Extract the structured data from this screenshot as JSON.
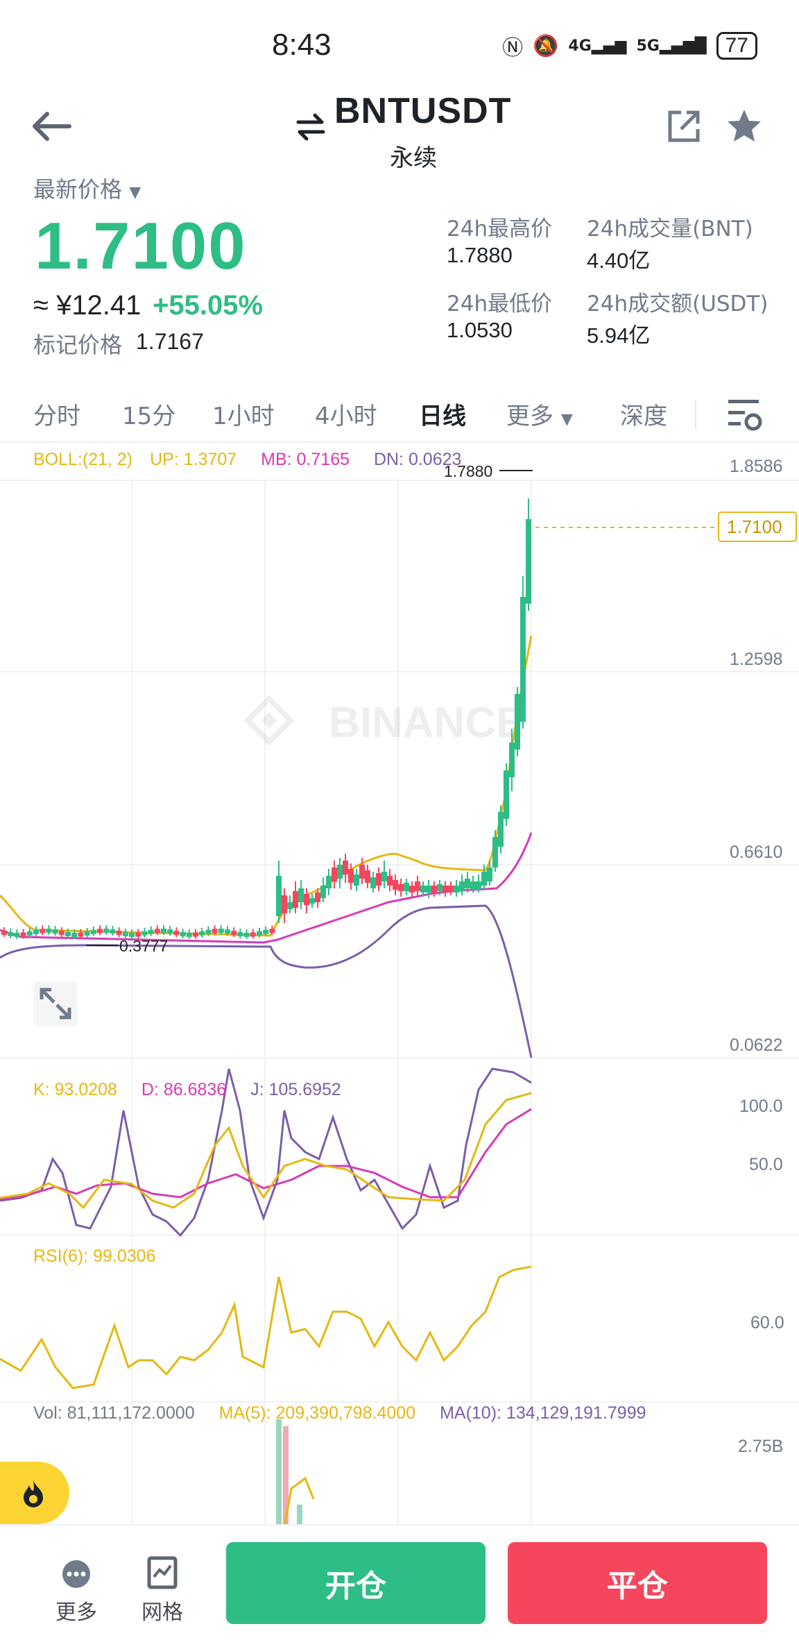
{
  "status": {
    "time": "8:43",
    "signal1": "4G",
    "signal2": "5G",
    "battery": "77"
  },
  "header": {
    "title": "BNTUSDT",
    "subtitle": "永续"
  },
  "price": {
    "label": "最新价格",
    "last": "1.7100",
    "cny": "≈ ¥12.41",
    "change": "+55.05%",
    "mark_label": "标记价格",
    "mark_value": "1.7167"
  },
  "stats": {
    "high_label": "24h最高价",
    "high_value": "1.7880",
    "low_label": "24h最低价",
    "low_value": "1.0530",
    "vol_label": "24h成交量(BNT)",
    "vol_value": "4.40亿",
    "amt_label": "24h成交额(USDT)",
    "amt_value": "5.94亿"
  },
  "tabs": [
    "分时",
    "15分",
    "1小时",
    "4小时",
    "日线",
    "更多",
    "深度"
  ],
  "active_tab": "日线",
  "boll": {
    "label": "BOLL:(21, 2)",
    "up": "UP: 1.3707",
    "mb": "MB: 0.7165",
    "dn": "DN: 0.0623"
  },
  "price_axis": [
    "1.8586",
    "1.2598",
    "0.6610",
    "0.0622"
  ],
  "current_price_tag": "1.7100",
  "high_marker": "1.7880",
  "low_marker": "0.3777",
  "watermark": "BINANCE",
  "kdj": {
    "k": "K: 93.0208",
    "d": "D: 86.6836",
    "j": "J: 105.6952",
    "axis": [
      "100.0",
      "50.0"
    ]
  },
  "rsi": {
    "label": "RSI(6): 99.0306",
    "axis": [
      "60.0"
    ]
  },
  "vol": {
    "vol": "Vol: 81,111,172.0000",
    "ma5": "MA(5): 209,390,798.4000",
    "ma10": "MA(10): 134,129,191.7999",
    "axis": [
      "2.75B"
    ]
  },
  "bottom": {
    "more": "更多",
    "grid": "网格",
    "open": "开仓",
    "close": "平仓"
  },
  "colors": {
    "up": "#2ebd85",
    "down": "#f6465d",
    "boll_up": "#e5b812",
    "boll_mb": "#d83ab5",
    "boll_dn": "#7b5ea7",
    "accent": "#fcd535"
  }
}
